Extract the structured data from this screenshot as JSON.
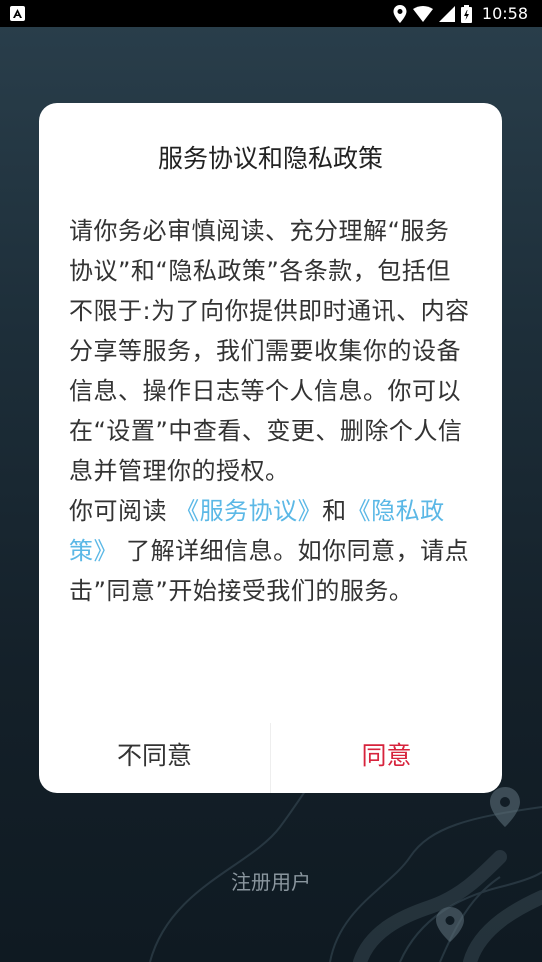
{
  "status_bar": {
    "time": "10:58",
    "icons": [
      "notification-a-icon",
      "location-icon",
      "wifi-icon",
      "signal-icon",
      "battery-icon"
    ]
  },
  "dialog": {
    "title": "服务协议和隐私政策",
    "paragraph1": "请你务必审慎阅读、充分理解“服务协议”和“隐私政策”各条款，包括但不限于:为了向你提供即时通讯、内容分享等服务，我们需要收集你的设备信息、操作日志等个人信息。你可以在“设置”中查看、变更、删除个人信息并管理你的授权。",
    "p2_prefix": "你可阅读 ",
    "service_link": "《服务协议》",
    "p2_and": "和",
    "privacy_link": "《隐私政策》",
    "p2_suffix": " 了解详细信息。如你同意，请点击”同意”开始接受我们的服务。",
    "disagree_label": "不同意",
    "agree_label": "同意"
  },
  "register_label": "注册用户",
  "colors": {
    "link": "#5bb8e6",
    "agree": "#d7233c",
    "background": "#1d2e39"
  }
}
